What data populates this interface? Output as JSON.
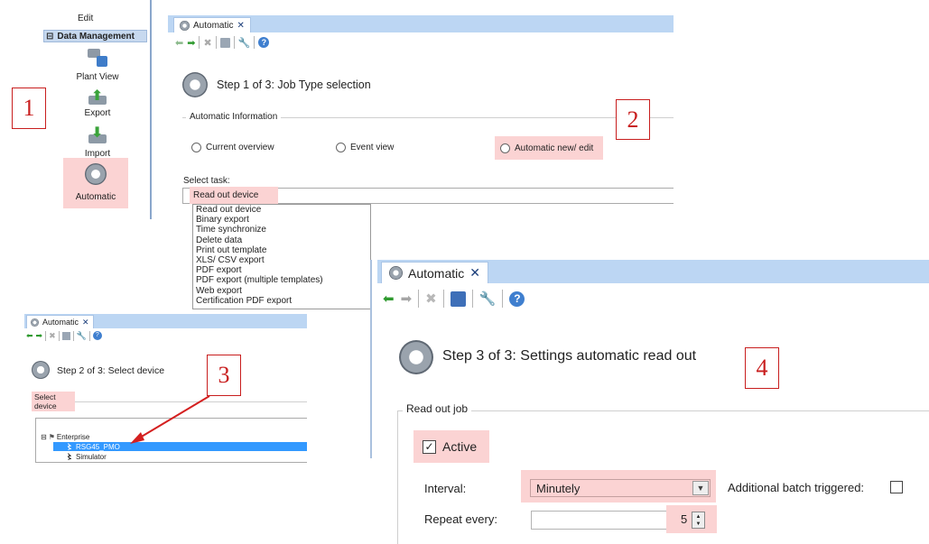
{
  "sidebar": {
    "edit_label": "Edit",
    "section_label": "Data Management",
    "section_toggle": "⊟",
    "items": [
      {
        "label": "Plant View",
        "icon": "plant-view-icon"
      },
      {
        "label": "Export",
        "icon": "export-icon"
      },
      {
        "label": "Import",
        "icon": "import-icon"
      },
      {
        "label": "Automatic",
        "icon": "gear-icon"
      }
    ]
  },
  "callouts": {
    "one": "1",
    "two": "2",
    "three": "3",
    "four": "4"
  },
  "panel1": {
    "tab_label": "Automatic",
    "tab_close": "✕",
    "step_title": "Step 1 of 3: Job Type selection",
    "group_label": "Automatic Information",
    "radios": [
      {
        "label": "Current overview",
        "selected": false
      },
      {
        "label": "Event view",
        "selected": false
      },
      {
        "label": "Automatic new/ edit",
        "selected": true
      }
    ],
    "select_task_label": "Select task:",
    "selected_task": "Read out device",
    "task_options": [
      "Read out device",
      "Binary export",
      "Time synchronize",
      "Delete data",
      "Print out template",
      "XLS/ CSV export",
      "PDF export",
      "PDF export (multiple templates)",
      "Web export",
      "Certification PDF export"
    ]
  },
  "panel2": {
    "tab_label": "Automatic",
    "tab_close": "✕",
    "step_title": "Step 2 of 3: Select device",
    "select_device_label": "Select device",
    "tree": {
      "root_toggle": "⊟",
      "root_label": "Enterprise",
      "children": [
        {
          "label": "RSG45_PMO",
          "selected": true
        },
        {
          "label": "Simulator",
          "selected": false
        }
      ]
    }
  },
  "panel4": {
    "tab_label": "Automatic",
    "tab_close": "✕",
    "step_title": "Step 3 of 3: Settings automatic read out",
    "group_label": "Read out job",
    "active_label": "Active",
    "active_checked": true,
    "interval_label": "Interval:",
    "interval_value": "Minutely",
    "additional_batch_label": "Additional batch triggered:",
    "repeat_label": "Repeat every:",
    "repeat_value": "5"
  },
  "colors": {
    "highlight": "#fbd3d3",
    "callout_red": "#c81e1e",
    "tabstrip_blue": "#bcd6f3",
    "selection_blue": "#3399ff"
  }
}
